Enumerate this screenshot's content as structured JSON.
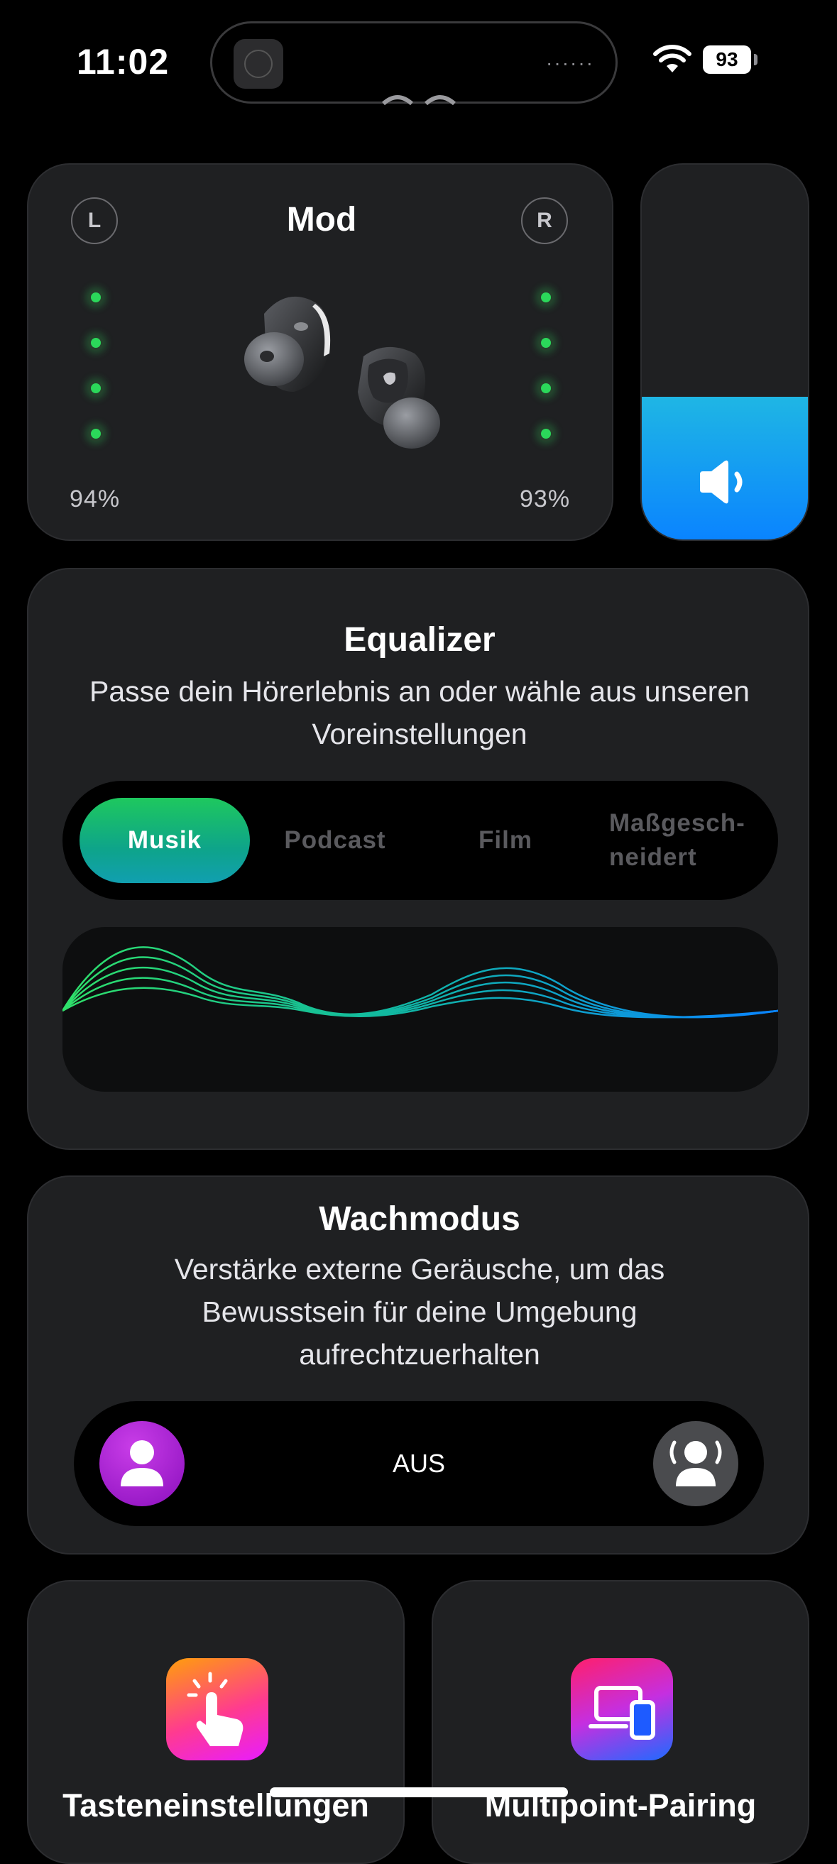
{
  "status_bar": {
    "time": "11:02",
    "battery": "93",
    "island_dots": "······"
  },
  "device_card": {
    "title": "Mod",
    "left_label": "L",
    "right_label": "R",
    "left_battery": "94%",
    "right_battery": "93%",
    "left_dots": 4,
    "right_dots": 4
  },
  "volume": {
    "level": 0.38,
    "icon": "speaker-icon"
  },
  "equalizer": {
    "title": "Equalizer",
    "subtitle": "Passe dein Hörerlebnis an oder wähle aus unseren Voreinstellungen",
    "presets": [
      "Musik",
      "Podcast",
      "Film",
      "Maßgesch-\nneidert"
    ],
    "active": "Musik"
  },
  "awareness": {
    "title": "Wachmodus",
    "subtitle": "Verstärke externe Geräusche, um das Bewusstsein für deine Umgebung aufrechtzuerhalten",
    "state": "AUS"
  },
  "shortcuts": [
    {
      "label": "Tasteneinstellungen",
      "icon": "tap-gesture-icon"
    },
    {
      "label": "Multipoint-Pairing",
      "icon": "devices-icon"
    }
  ],
  "colors": {
    "accent_green": "#2bd85a",
    "volume_blue": "#0a84ff",
    "toggle_purple": "#b12fd6"
  }
}
